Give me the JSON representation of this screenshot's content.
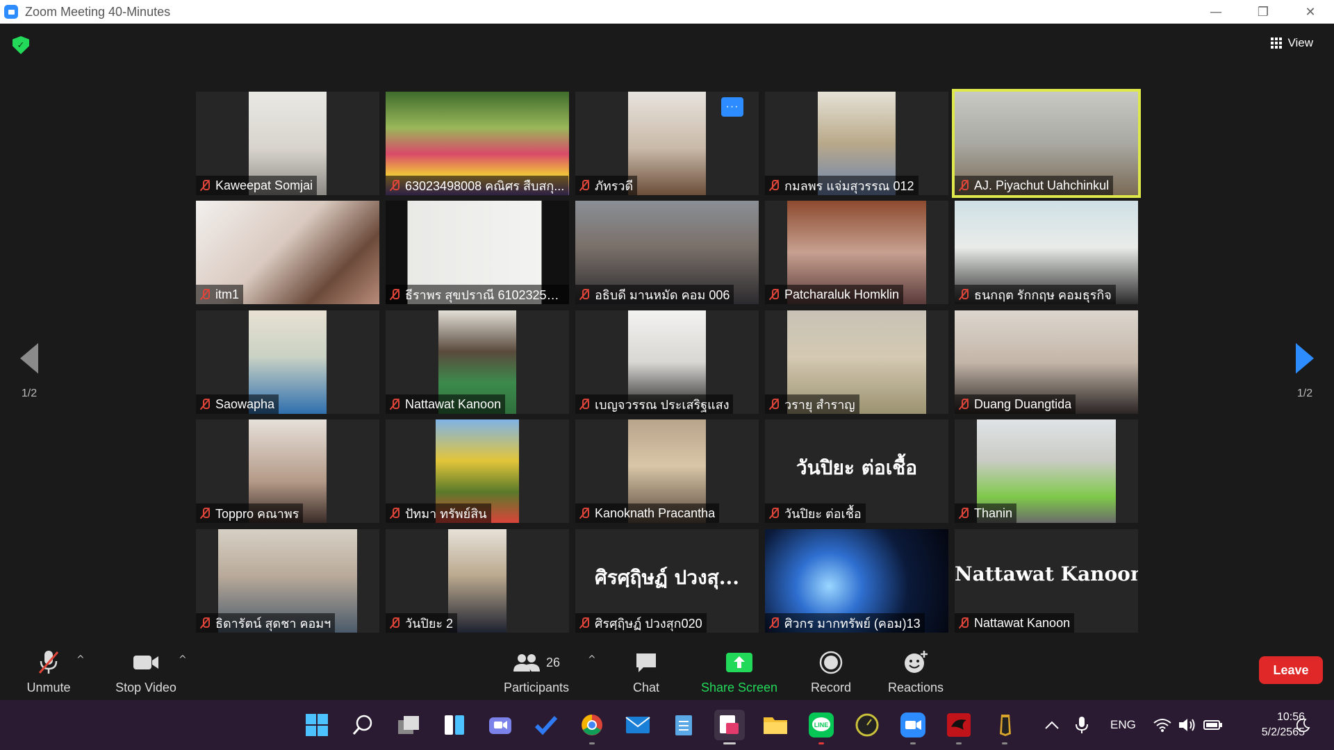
{
  "window": {
    "title": "Zoom Meeting 40-Minutes",
    "controls": [
      "—",
      "❐",
      "✕"
    ]
  },
  "view_button": {
    "label": "View"
  },
  "pagination": {
    "left": "1/2",
    "right": "1/2"
  },
  "more_button": {
    "label": "···"
  },
  "participants_tiles": [
    {
      "name": "Kaweepat Somjai"
    },
    {
      "name": "63023498008 คณิศร สืบสกุ..."
    },
    {
      "name": "ภัทรวดี"
    },
    {
      "name": "กมลพร แจ่มสุวรรณ 012"
    },
    {
      "name": "AJ. Piyachut Uahchinkul"
    },
    {
      "name": "itm1"
    },
    {
      "name": "ธีราพร สุขปราณี 610232570..."
    },
    {
      "name": "อธิบดี มานหมัด คอม 006"
    },
    {
      "name": "Patcharaluk Homklin"
    },
    {
      "name": "ธนกฤต รักกฤษ คอมธุรกิจ"
    },
    {
      "name": "Saowapha"
    },
    {
      "name": "Nattawat Kanoon"
    },
    {
      "name": "เบญจวรรณ ประเสริฐแสง"
    },
    {
      "name": "วรายุ สำราญ"
    },
    {
      "name": "Duang Duangtida"
    },
    {
      "name": "Toppro คณาพร"
    },
    {
      "name": "ปัทมา ทรัพย์สิน"
    },
    {
      "name": "Kanoknath Pracantha"
    },
    {
      "name": "วันปิยะ ต่อเชื้อ",
      "big_name": "วันปิยะ ต่อเชื้อ"
    },
    {
      "name": "Thanin"
    },
    {
      "name": "ธิดารัตน์ สุดชา คอมฯ"
    },
    {
      "name": "วันปิยะ 2"
    },
    {
      "name": "ศิรศฺฤิษฏ์ ปวงสุก020",
      "big_name": "ศิรศฺฤิษฏ์ ปวงสุ..."
    },
    {
      "name": "ศิวกร มากทรัพย์ (คอม)13"
    },
    {
      "name": "Nattawat Kanoon",
      "big_name": "Nattawat Kanoon"
    }
  ],
  "controls": {
    "unmute": "Unmute",
    "stop_video": "Stop Video",
    "participants": "Participants",
    "participants_count": "26",
    "chat": "Chat",
    "share_screen": "Share Screen",
    "record": "Record",
    "reactions": "Reactions",
    "leave": "Leave"
  },
  "taskbar": {
    "language": "ENG",
    "time": "10:56",
    "date": "5/2/2565"
  },
  "colors": {
    "accent": "#2d8cff",
    "share_green": "#23d959",
    "leave_red": "#e02828",
    "active_speaker": "#dfe84a",
    "taskbar_bg": "#2a1b33"
  }
}
